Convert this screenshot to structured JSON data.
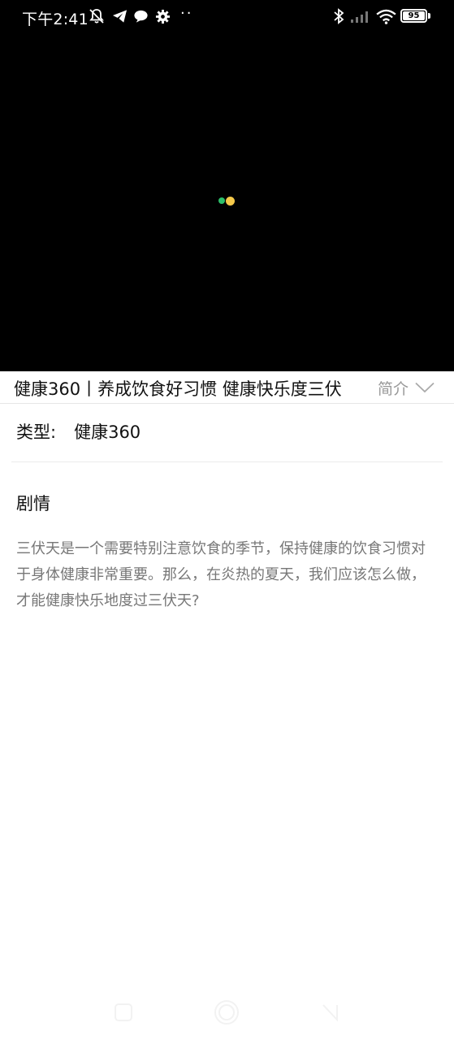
{
  "status_bar": {
    "time": "下午2:41",
    "battery": "95",
    "dots": "··",
    "icons": [
      "muted-bell-icon",
      "telegram-icon",
      "message-icon",
      "gear-icon",
      "bluetooth-icon",
      "signal-icon",
      "wifi-icon",
      "battery-icon"
    ]
  },
  "player": {
    "loader_colors": [
      "#2dbf6a",
      "#f5c94a"
    ]
  },
  "header": {
    "title": "健康360丨养成饮食好习惯 健康快乐度三伏",
    "intro_label": "简介",
    "intro_icon": "chevron-down-icon"
  },
  "details": {
    "type_label": "类型:",
    "type_value": "健康360",
    "plot_heading": "剧情",
    "plot_text": "三伏天是一个需要特别注意饮食的季节，保持健康的饮食习惯对于身体健康非常重要。那么，在炎热的夏天，我们应该怎么做，才能健康快乐地度过三伏天?"
  },
  "nav": {
    "icons": [
      "recents-icon",
      "home-icon",
      "back-icon"
    ]
  }
}
